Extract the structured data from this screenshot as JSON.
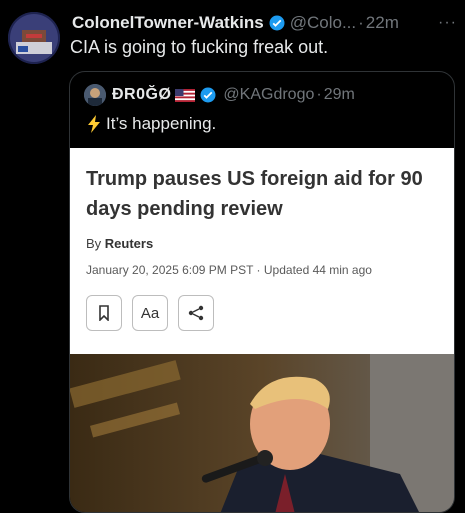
{
  "tweet": {
    "author_name": "ColonelTowner-Watkins",
    "handle": "@Colo...",
    "separator": "·",
    "time": "22m",
    "more": "···",
    "text": "CIA is going to fucking freak out."
  },
  "quoted": {
    "author_name": "ÐR0ĞØ",
    "handle": "@KAGdrogo",
    "separator": "·",
    "time": "29m",
    "text": "It’s happening."
  },
  "article": {
    "headline": "Trump pauses US foreign aid for 90 days pending review",
    "byline_prefix": "By ",
    "source": "Reuters",
    "dateline": "January 20, 2025 6:09 PM PST · Updated 44 min ago",
    "font_button": "Aa"
  },
  "colors": {
    "background": "#000000",
    "verified": "#1d9bf0",
    "muted": "#71767b"
  }
}
